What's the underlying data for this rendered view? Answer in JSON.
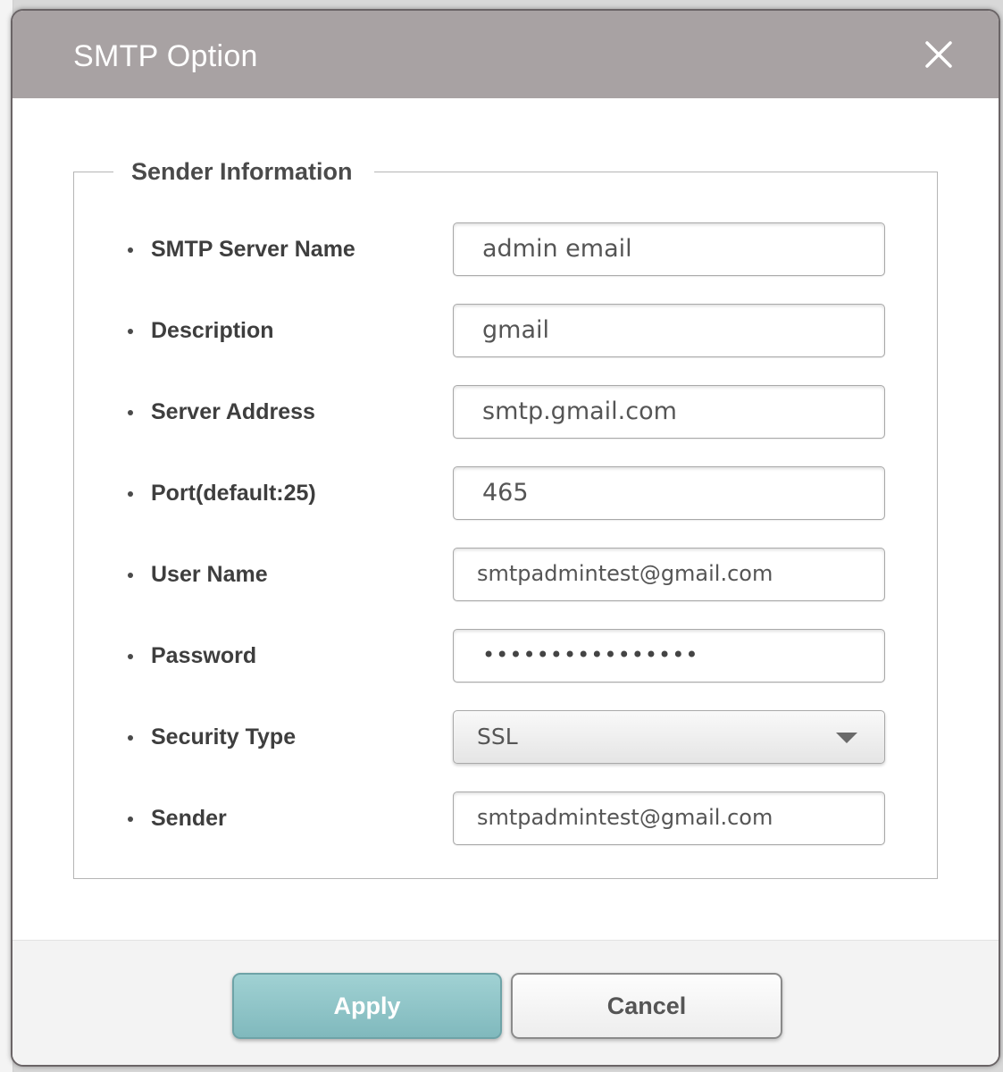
{
  "dialog": {
    "title": "SMTP Option",
    "close_icon": "close-icon"
  },
  "sender_info": {
    "legend": "Sender Information",
    "fields": [
      {
        "label": "SMTP Server Name",
        "value": "admin email"
      },
      {
        "label": "Description",
        "value": "gmail"
      },
      {
        "label": "Server Address",
        "value": "smtp.gmail.com"
      },
      {
        "label": "Port(default:25)",
        "value": "465"
      },
      {
        "label": "User Name",
        "value": "smtpadmintest@gmail.com"
      },
      {
        "label": "Password",
        "value": "••••••••••••••••"
      },
      {
        "label": "Security Type",
        "value": "SSL"
      },
      {
        "label": "Sender",
        "value": "smtpadmintest@gmail.com"
      }
    ]
  },
  "buttons": {
    "apply": "Apply",
    "cancel": "Cancel"
  },
  "colors": {
    "titlebar": "#a8a2a3",
    "apply_button": "#8fc4c7"
  }
}
